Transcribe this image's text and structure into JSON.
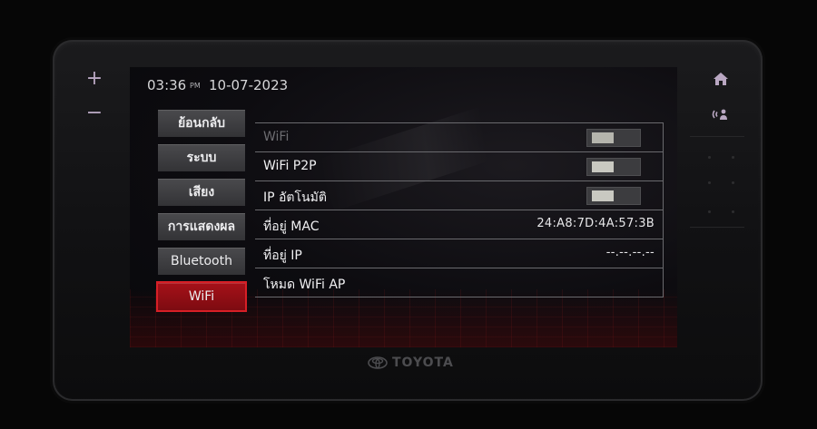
{
  "status": {
    "time": "03:36",
    "ampm": "PM",
    "date": "10-07-2023"
  },
  "hardware": {
    "volume_up": "+",
    "volume_down": "−",
    "home_icon": "home-icon",
    "voice_icon": "voice-command-icon",
    "brand": "TOYOTA"
  },
  "nav": [
    {
      "label": "ย้อนกลับ"
    },
    {
      "label": "ระบบ"
    },
    {
      "label": "เสียง"
    },
    {
      "label": "การแสดงผล"
    },
    {
      "label": "Bluetooth"
    },
    {
      "label": "WiFi"
    }
  ],
  "settings": [
    {
      "label": "WiFi",
      "type": "toggle",
      "state": "off",
      "disabled": true
    },
    {
      "label": "WiFi P2P",
      "type": "toggle",
      "state": "off"
    },
    {
      "label": "IP อัตโนมัติ",
      "type": "toggle",
      "state": "off"
    },
    {
      "label": "ที่อยู่ MAC",
      "type": "value",
      "value": "24:A8:7D:4A:57:3B"
    },
    {
      "label": "ที่อยู่ IP",
      "type": "value",
      "value": "--.--.--.--"
    },
    {
      "label": "โหมด WiFi AP",
      "type": "link"
    }
  ],
  "colors": {
    "accent": "#a61119",
    "accent_border": "#d71f26"
  }
}
